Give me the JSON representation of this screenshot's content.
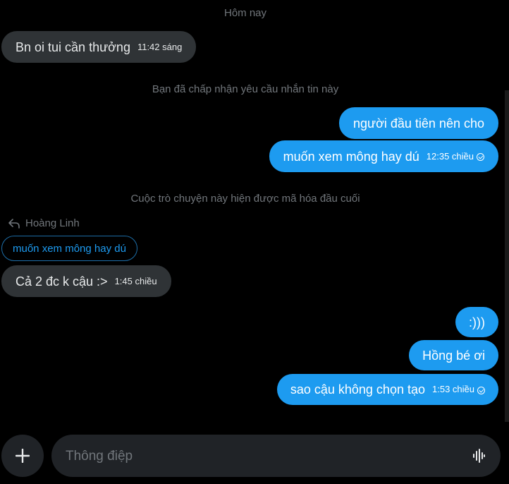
{
  "day_label": "Hôm nay",
  "notices": {
    "accepted": "Bạn đã chấp nhận yêu cầu nhắn tin này",
    "encrypted": "Cuộc trò chuyện này hiện được mã hóa đầu cuối"
  },
  "messages": [
    {
      "text": "Bn oi tui cần thưởng",
      "time": "11:42 sáng",
      "direction": "incoming"
    },
    {
      "text": "người đầu tiên nên cho",
      "time": "",
      "direction": "outgoing"
    },
    {
      "text": "muốn xem mông hay dú",
      "time": "12:35 chiều",
      "direction": "outgoing"
    },
    {
      "text": "Cả 2 đc k cậu :>",
      "time": "1:45 chiều",
      "direction": "incoming"
    },
    {
      "text": ":)))",
      "time": "",
      "direction": "outgoing"
    },
    {
      "text": "Hồng bé ơi",
      "time": "",
      "direction": "outgoing"
    },
    {
      "text": "sao cậu không chọn tạo",
      "time": "1:53 chiều",
      "direction": "outgoing"
    }
  ],
  "reply": {
    "author": "Hoàng Linh",
    "quoted_text": "muốn xem mông hay dú"
  },
  "composer": {
    "placeholder": "Thông điệp"
  },
  "icons": {
    "reply": "reply-arrow-icon",
    "sent": "sent-check-icon",
    "add": "plus-icon",
    "voice": "voice-wave-icon"
  },
  "colors": {
    "background": "#000000",
    "incoming_bubble": "#2f3336",
    "outgoing_bubble": "#1d9bf0",
    "muted_text": "#71767b"
  }
}
